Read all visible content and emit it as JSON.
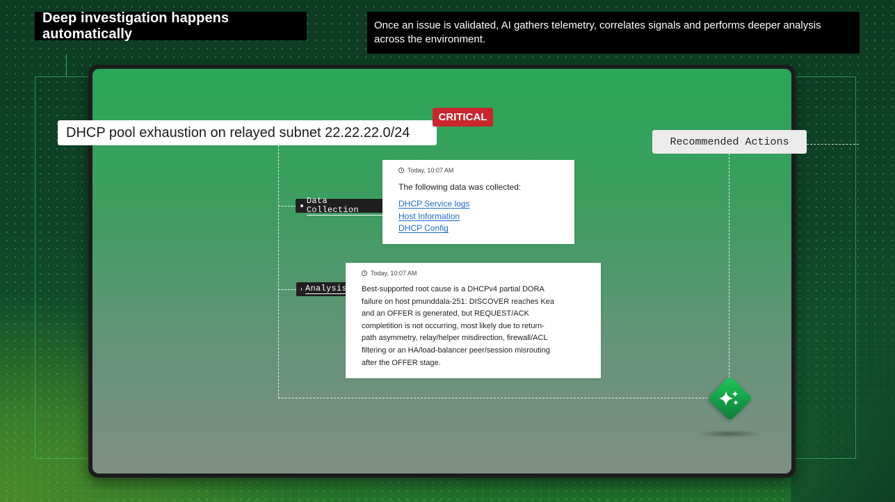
{
  "header": {
    "title": "Deep investigation happens automatically",
    "description": "Once an issue is validated, AI gathers telemetry, correlates signals and performs deeper analysis across the environment."
  },
  "incident": {
    "title": "DHCP pool exhaustion on relayed subnet 22.22.22.0/24",
    "severity": "CRITICAL",
    "severity_color": "#c8262d"
  },
  "recommended_actions_label": "Recommended Actions",
  "data_collection": {
    "tag": "Data Collection",
    "timestamp": "Today, 10:07 AM",
    "intro": "The following data was collected:",
    "links": [
      "DHCP Service logs",
      "Host Information",
      "DHCP Config"
    ]
  },
  "analysis": {
    "tag": "Analysis",
    "timestamp": "Today, 10:07 AM",
    "lines": [
      "Best-supported root cause is a DHCPv4 partial DORA",
      "failure on host pmunddala-251: DISCOVER reaches Kea",
      "and an OFFER is generated, but REQUEST/ACK",
      "completition is not occurring, most likely due to return-",
      "path asymmetry, relay/helper misdirection, firewall/ACL",
      "filtering or an HA/load-balancer peer/session misrouting",
      "after the OFFER stage."
    ]
  },
  "icons": {
    "ai": "sparkle-icon",
    "clock": "clock-icon"
  },
  "colors": {
    "accent_green": "#1fc85a",
    "link_blue": "#1f68c6"
  }
}
